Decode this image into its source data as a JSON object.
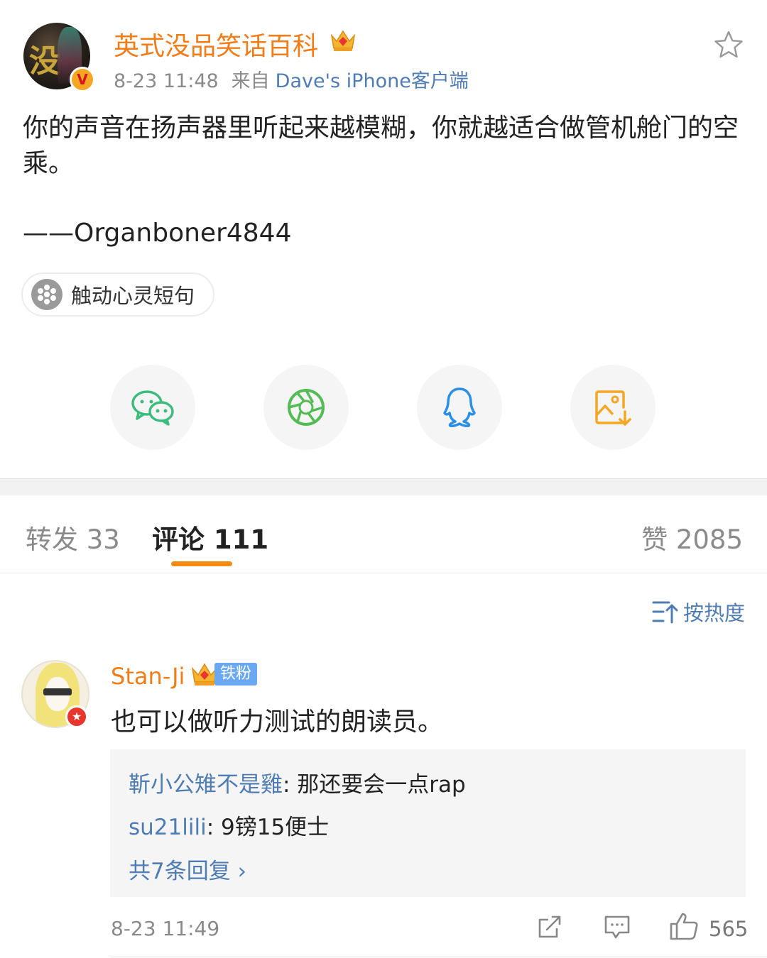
{
  "post": {
    "author": "英式没品笑话百科",
    "time": "8-23 11:48",
    "from_label": "来自",
    "client": "Dave's iPhone客户端",
    "body": "你的声音在扬声器里听起来越模糊，你就越适合做管机舱门的空乘。",
    "signature": "——Organboner4844",
    "topic": "触动心灵短句",
    "avatar_glyph": "没"
  },
  "share": {
    "items": [
      {
        "icon": "wechat-icon",
        "color": "#3dbd7d"
      },
      {
        "icon": "moments-icon",
        "color": "#55bb55"
      },
      {
        "icon": "qq-icon",
        "color": "#2c8fe6"
      },
      {
        "icon": "save-image-icon",
        "color": "#f5a623"
      }
    ]
  },
  "tabs": {
    "repost": "转发 33",
    "comments": "评论 111",
    "likes": "赞 2085"
  },
  "sort_label": "按热度",
  "comment": {
    "user": "Stan-Ji",
    "fan_badge": "铁粉",
    "text": "也可以做听力测试的朗读员。",
    "replies": [
      {
        "user": "靳小公雉不是雞",
        "text": ": 那还要会一点rap"
      },
      {
        "user": "su21lili",
        "text": ": 9镑15便士"
      }
    ],
    "more_replies": "共7条回复 ›",
    "time": "8-23 11:49",
    "like_count": "565"
  },
  "colors": {
    "accent_orange": "#f07d18",
    "link_blue": "#4f7db3",
    "tab_indicator": "#f58b12"
  }
}
